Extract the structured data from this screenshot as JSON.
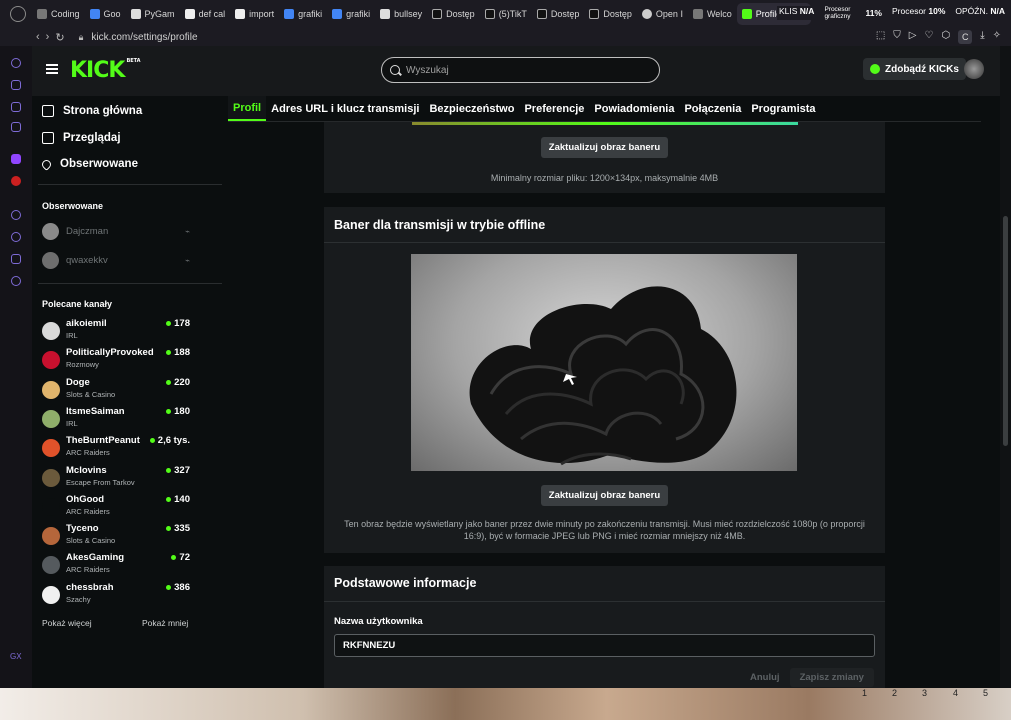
{
  "browser": {
    "tabs": [
      {
        "label": "Coding"
      },
      {
        "label": "Goo"
      },
      {
        "label": "PyGam"
      },
      {
        "label": "def cal"
      },
      {
        "label": "import"
      },
      {
        "label": "grafiki"
      },
      {
        "label": "grafiki"
      },
      {
        "label": "bullsey"
      },
      {
        "label": "Dostęp"
      },
      {
        "label": "(5)TikT"
      },
      {
        "label": "Dostęp"
      },
      {
        "label": "Dostęp"
      },
      {
        "label": "Open I"
      },
      {
        "label": "Welco"
      },
      {
        "label": "Profile - Kick"
      }
    ],
    "sys": {
      "klis_label": "KLIS",
      "klis_value": "N/A",
      "gpu_label": "Procesor graficzny",
      "gpu_value": "11%",
      "cpu_label": "Procesor",
      "cpu_value": "10%",
      "delay_label": "OPÓŹN.",
      "delay_value": "N/A"
    },
    "url": "kick.com/settings/profile"
  },
  "header": {
    "logo": "KICK",
    "logo_beta": "BETA",
    "search_placeholder": "Wyszukaj",
    "kicks_button": "Zdobądź KICKs"
  },
  "sidebar": {
    "nav": [
      {
        "label": "Strona główna"
      },
      {
        "label": "Przeglądaj"
      },
      {
        "label": "Obserwowane"
      }
    ],
    "followed_title": "Obserwowane",
    "followed": [
      {
        "name": "Dajczman"
      },
      {
        "name": "qwaxekkv"
      }
    ],
    "recommended_title": "Polecane kanały",
    "channels": [
      {
        "name": "aikoiemil",
        "category": "IRL",
        "viewers": "178",
        "color": "#d9d9d9"
      },
      {
        "name": "PoliticallyProvoked",
        "category": "Rozmowy",
        "viewers": "188",
        "color": "#c8102e"
      },
      {
        "name": "Doge",
        "category": "Slots & Casino",
        "viewers": "220",
        "color": "#e0b46c"
      },
      {
        "name": "ItsmeSaiman",
        "category": "IRL",
        "viewers": "180",
        "color": "#8fae6a"
      },
      {
        "name": "TheBurntPeanut",
        "category": "ARC Raiders",
        "viewers": "2,6 tys.",
        "color": "#e0522a"
      },
      {
        "name": "Mclovins",
        "category": "Escape From Tarkov",
        "viewers": "327",
        "color": "#6b5a3c"
      },
      {
        "name": "OhGood",
        "category": "ARC Raiders",
        "viewers": "140",
        "color": "#0b0e0f"
      },
      {
        "name": "Tyceno",
        "category": "Slots & Casino",
        "viewers": "335",
        "color": "#b5663b"
      },
      {
        "name": "AkesGaming",
        "category": "ARC Raiders",
        "viewers": "72",
        "color": "#555a5e"
      },
      {
        "name": "chessbrah",
        "category": "Szachy",
        "viewers": "386",
        "color": "#f0f0f0"
      }
    ],
    "show_more": "Pokaż więcej",
    "show_less": "Pokaż mniej"
  },
  "profile_tabs": [
    {
      "label": "Profil"
    },
    {
      "label": "Adres URL i klucz transmisji"
    },
    {
      "label": "Bezpieczeństwo"
    },
    {
      "label": "Preferencje"
    },
    {
      "label": "Powiadomienia"
    },
    {
      "label": "Połączenia"
    },
    {
      "label": "Programista"
    }
  ],
  "banner_card": {
    "update_button": "Zaktualizuj obraz baneru",
    "hint": "Minimalny rozmiar pliku: 1200×134px, maksymalnie 4MB"
  },
  "offline_card": {
    "title": "Baner dla transmisji w trybie offline",
    "update_button": "Zaktualizuj obraz baneru",
    "hint": "Ten obraz będzie wyświetlany jako baner przez dwie minuty po zakończeniu transmisji. Musi mieć rozdzielczość 1080p (o proporcji 16:9), być w formacie JPEG lub PNG i mieć rozmiar mniejszy niż 4MB."
  },
  "basic_card": {
    "title": "Podstawowe informacje",
    "username_label": "Nazwa użytkownika",
    "username_value": "RKFNNEZU",
    "cancel": "Anuluj",
    "save": "Zapisz zmiany"
  },
  "gx_label": "GX",
  "taskbar_numbers": [
    "1",
    "2",
    "3",
    "4",
    "5"
  ]
}
